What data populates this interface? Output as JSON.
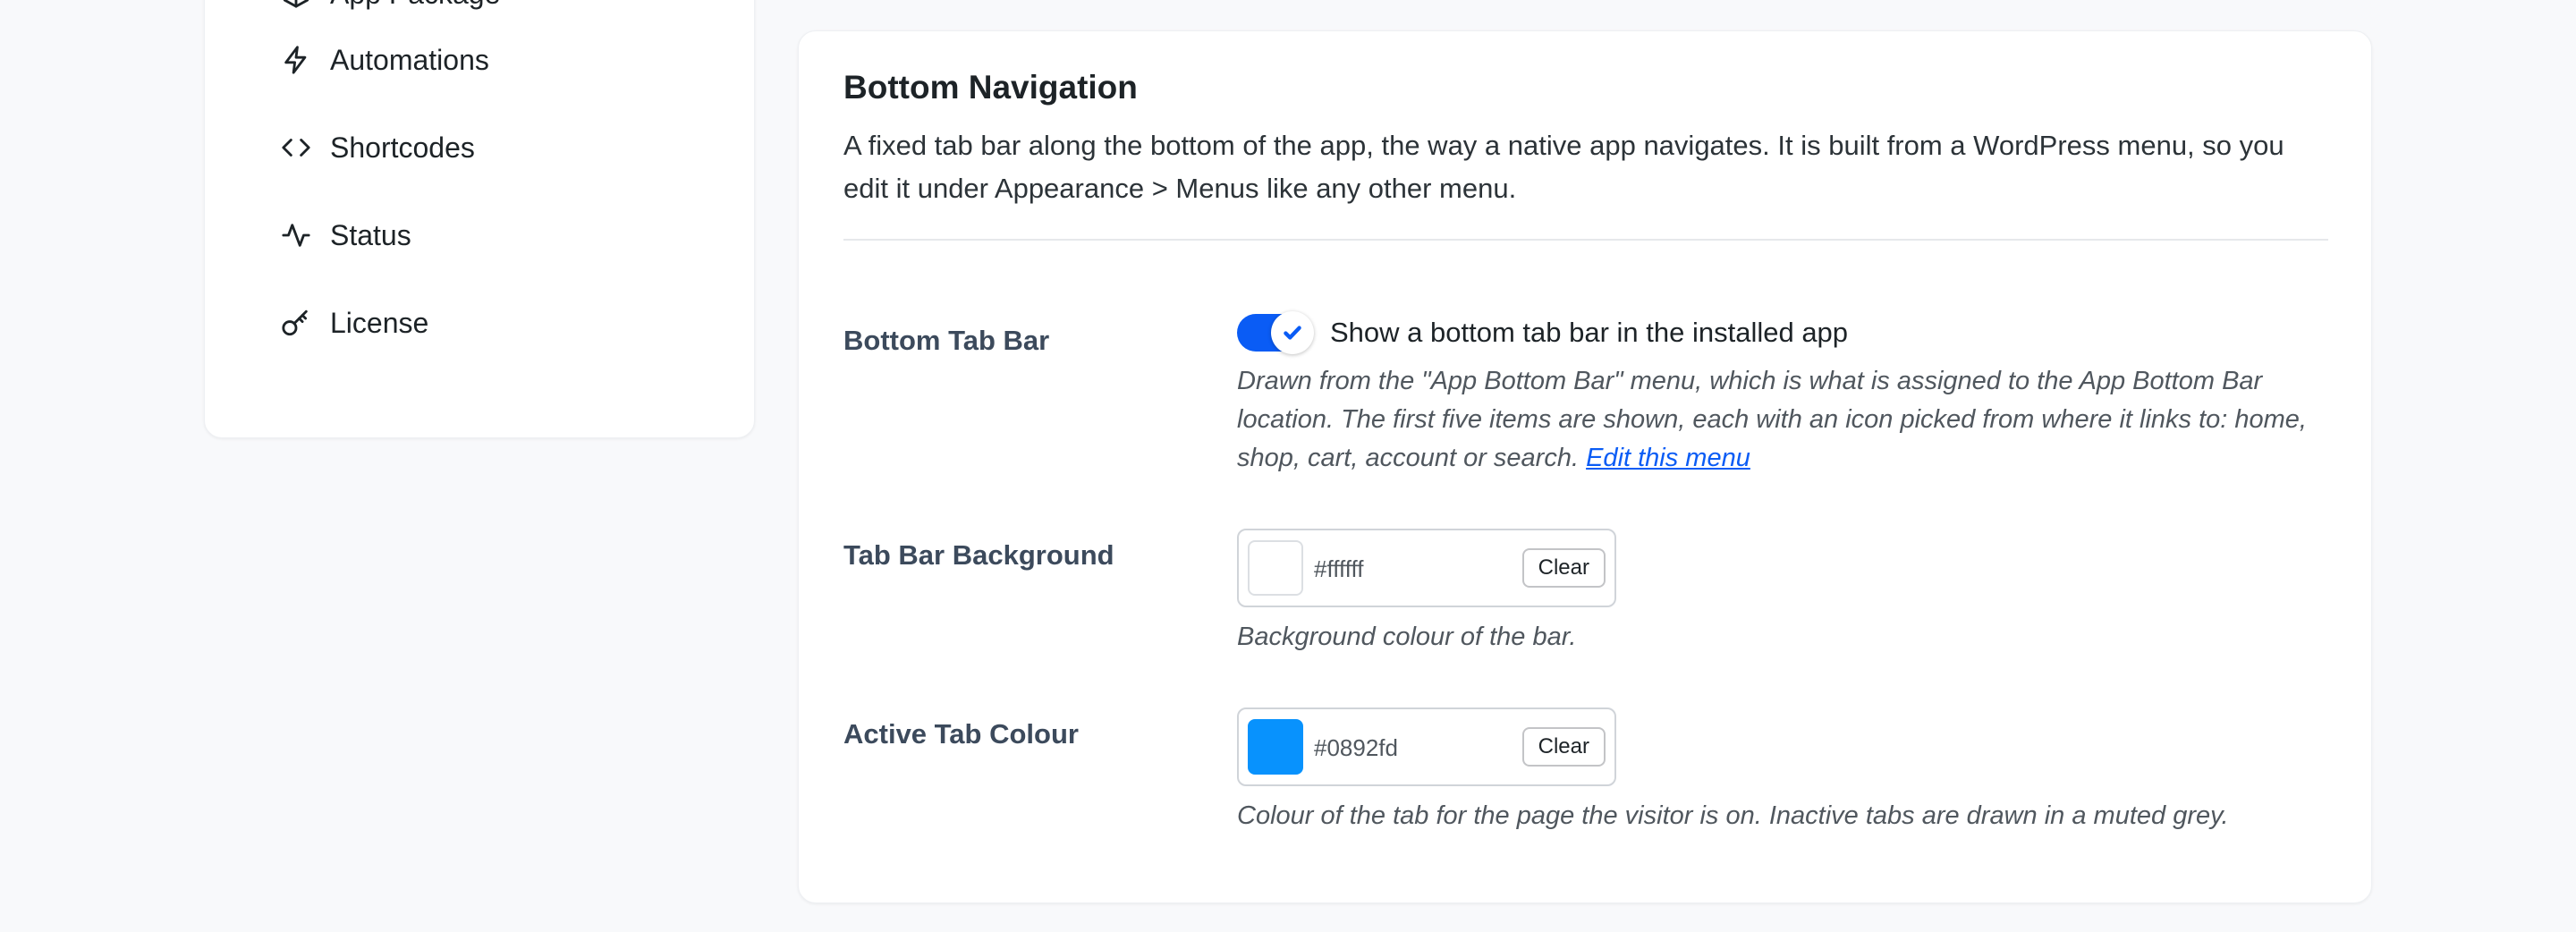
{
  "sidebar": {
    "items": [
      {
        "label": "App Package",
        "icon": "package-icon"
      },
      {
        "label": "Automations",
        "icon": "lightning-icon"
      },
      {
        "label": "Shortcodes",
        "icon": "code-icon"
      },
      {
        "label": "Status",
        "icon": "activity-icon"
      },
      {
        "label": "License",
        "icon": "key-icon"
      }
    ]
  },
  "panel": {
    "title": "Bottom Navigation",
    "description": "A fixed tab bar along the bottom of the app, the way a native app navigates. It is built from a WordPress menu, so you edit it under Appearance > Menus like any other menu.",
    "bottom_tab_bar": {
      "label": "Bottom Tab Bar",
      "toggle_enabled": true,
      "toggle_text": "Show a bottom tab bar in the installed app",
      "help_text": "Drawn from the \"App Bottom Bar\" menu, which is what is assigned to the App Bottom Bar location. The first five items are shown, each with an icon picked from where it links to: home, shop, cart, account or search. ",
      "edit_link": "Edit this menu"
    },
    "tab_bar_background": {
      "label": "Tab Bar Background",
      "value": "#ffffff",
      "clear_label": "Clear",
      "help_text": "Background colour of the bar."
    },
    "active_tab_colour": {
      "label": "Active Tab Colour",
      "value": "#0892fd",
      "clear_label": "Clear",
      "help_text": "Colour of the tab for the page the visitor is on. Inactive tabs are drawn in a muted grey."
    }
  },
  "colors": {
    "accent": "#0a5cf5",
    "swatch_background": "#ffffff",
    "swatch_active": "#0892fd"
  }
}
